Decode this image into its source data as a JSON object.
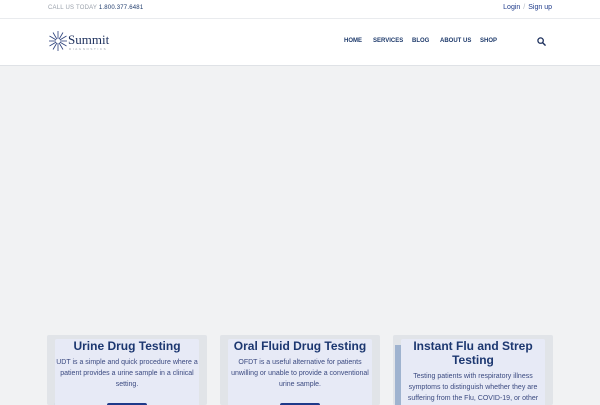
{
  "topbar": {
    "call_label": "CALL US TODAY",
    "phone": "1.800.377.6481",
    "login": "Login",
    "separator": "/",
    "signup": "Sign up"
  },
  "logo": {
    "brand": "Summit",
    "tagline": "DIAGNOSTICS"
  },
  "nav": {
    "items": [
      "HOME",
      "SERVICES",
      "BLOG",
      "ABOUT US",
      "SHOP"
    ]
  },
  "cards": [
    {
      "title": "Urine Drug Testing",
      "body": "UDT is a simple and quick procedure where a patient provides a urine sample in a clinical setting."
    },
    {
      "title": "Oral Fluid Drug Testing",
      "body": "OFDT is a useful alternative for patients unwilling or unable to provide a conventional urine sample."
    },
    {
      "title": "Instant Flu and Strep Testing",
      "body": "Testing patients with respiratory illness symptoms to distinguish whether they are suffering from the Flu, COVID-19, or other"
    }
  ],
  "colors": {
    "brand_navy": "#1c2f5c",
    "link_blue": "#1e3a8a",
    "card_text": "#3b4a80"
  },
  "icons": {
    "search": "search-icon",
    "logo_mark": "sunburst-logo-icon"
  }
}
